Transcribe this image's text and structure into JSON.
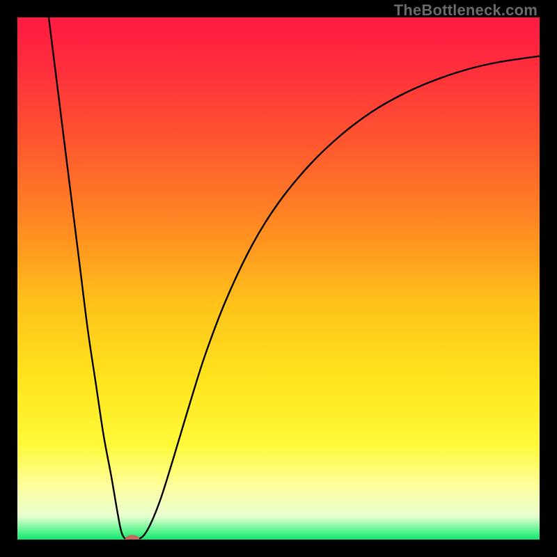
{
  "watermark": "TheBottleneck.com",
  "chart_data": {
    "type": "line",
    "title": "",
    "xlabel": "",
    "ylabel": "",
    "xlim": [
      0,
      100
    ],
    "ylim": [
      0,
      100
    ],
    "grid": false,
    "background_gradient": {
      "stops": [
        {
          "offset": 0.0,
          "color": "#ff1a42"
        },
        {
          "offset": 0.1,
          "color": "#ff2f3c"
        },
        {
          "offset": 0.25,
          "color": "#ff5a2e"
        },
        {
          "offset": 0.4,
          "color": "#ff8a22"
        },
        {
          "offset": 0.55,
          "color": "#ffc21a"
        },
        {
          "offset": 0.7,
          "color": "#ffe61e"
        },
        {
          "offset": 0.82,
          "color": "#fff93a"
        },
        {
          "offset": 0.9,
          "color": "#fdffa0"
        },
        {
          "offset": 0.955,
          "color": "#e8ffd0"
        },
        {
          "offset": 0.985,
          "color": "#53f58c"
        },
        {
          "offset": 1.0,
          "color": "#17e36e"
        }
      ]
    },
    "series": [
      {
        "name": "bottleneck-curve",
        "stroke": "#000000",
        "stroke_width": 2.4,
        "points": [
          {
            "x": 6.0,
            "y": 100.0
          },
          {
            "x": 7.5,
            "y": 88.0
          },
          {
            "x": 9.0,
            "y": 76.0
          },
          {
            "x": 10.5,
            "y": 64.0
          },
          {
            "x": 12.0,
            "y": 52.0
          },
          {
            "x": 13.5,
            "y": 40.0
          },
          {
            "x": 15.0,
            "y": 30.0
          },
          {
            "x": 16.5,
            "y": 20.0
          },
          {
            "x": 18.0,
            "y": 12.0
          },
          {
            "x": 19.2,
            "y": 5.0
          },
          {
            "x": 20.0,
            "y": 1.2
          },
          {
            "x": 21.0,
            "y": 0.0
          },
          {
            "x": 22.5,
            "y": 0.0
          },
          {
            "x": 24.0,
            "y": 0.6
          },
          {
            "x": 25.5,
            "y": 3.0
          },
          {
            "x": 27.5,
            "y": 8.0
          },
          {
            "x": 30.0,
            "y": 16.0
          },
          {
            "x": 33.0,
            "y": 26.0
          },
          {
            "x": 36.0,
            "y": 35.5
          },
          {
            "x": 40.0,
            "y": 46.0
          },
          {
            "x": 45.0,
            "y": 56.5
          },
          {
            "x": 50.0,
            "y": 64.5
          },
          {
            "x": 56.0,
            "y": 71.8
          },
          {
            "x": 62.0,
            "y": 77.5
          },
          {
            "x": 68.0,
            "y": 82.0
          },
          {
            "x": 74.0,
            "y": 85.4
          },
          {
            "x": 80.0,
            "y": 88.0
          },
          {
            "x": 86.0,
            "y": 90.0
          },
          {
            "x": 92.0,
            "y": 91.4
          },
          {
            "x": 100.0,
            "y": 92.6
          }
        ]
      }
    ],
    "marker": {
      "name": "optimal-point",
      "x": 22.0,
      "y": 0.0,
      "rx": 1.4,
      "ry": 0.9,
      "fill": "#c46a5f"
    }
  }
}
